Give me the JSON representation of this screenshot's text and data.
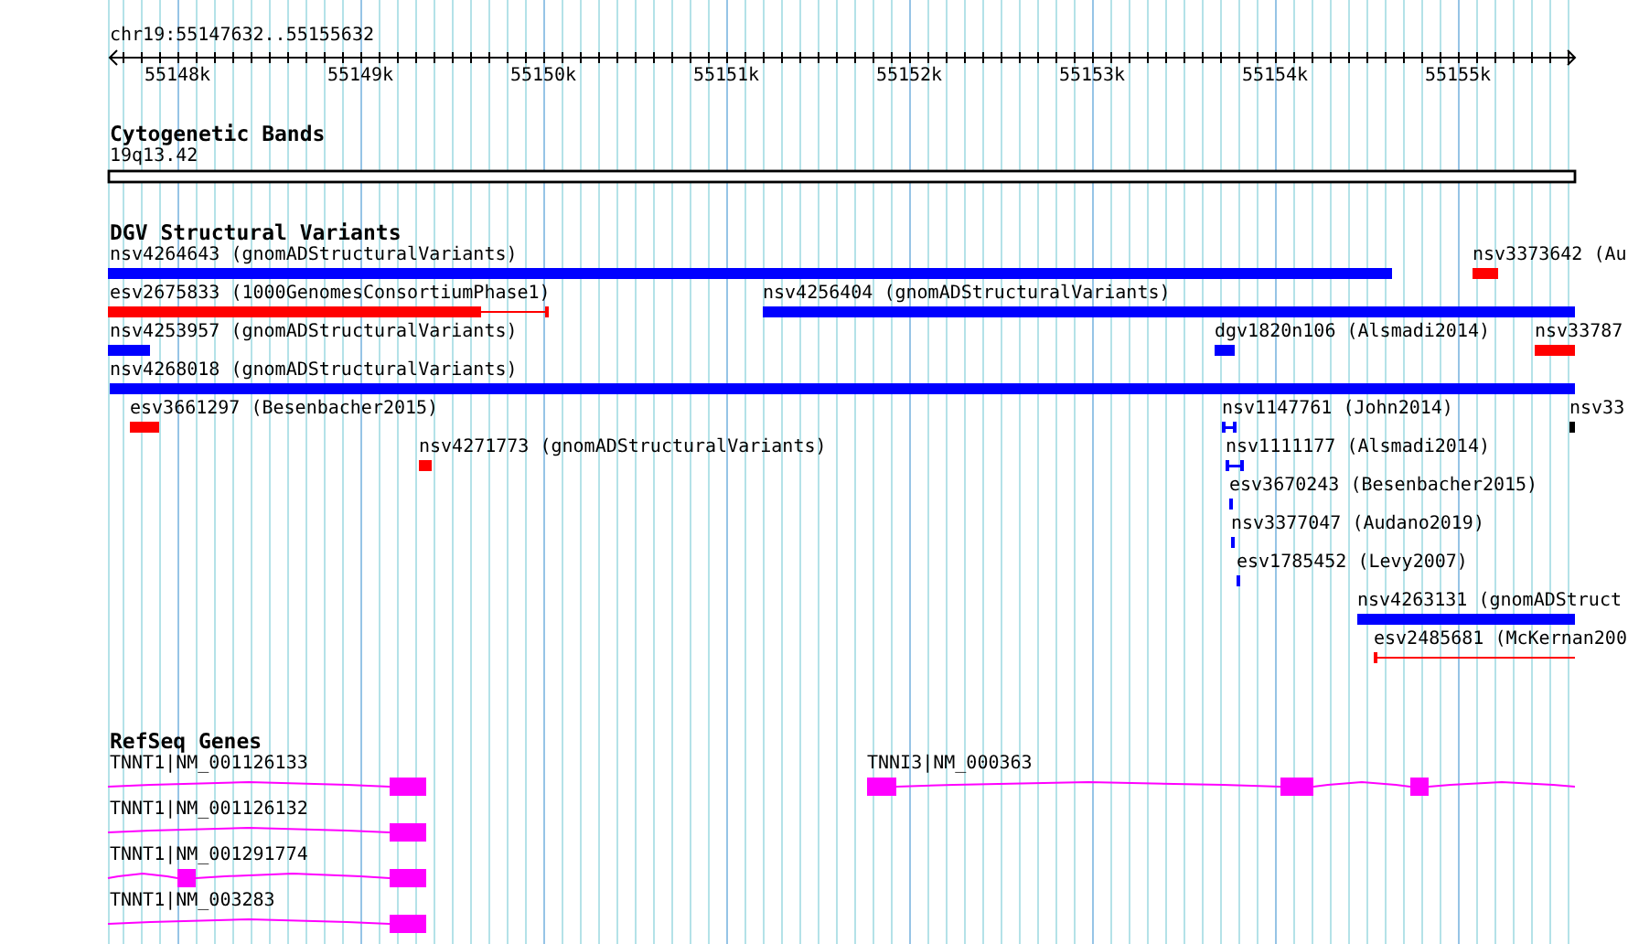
{
  "ruler": {
    "location": "chr19:55147632..55155632",
    "ticks": [
      {
        "label": "55148k"
      },
      {
        "label": "55149k"
      },
      {
        "label": "55150k"
      },
      {
        "label": "55151k"
      },
      {
        "label": "55152k"
      },
      {
        "label": "55153k"
      },
      {
        "label": "55154k"
      },
      {
        "label": "55155k"
      }
    ]
  },
  "tracks": [
    {
      "kind": "bands",
      "title": "Cytogenetic Bands",
      "band": {
        "label": "19q13.42"
      }
    },
    {
      "kind": "variants",
      "title": "DGV Structural Variants",
      "rows": [
        {
          "features": [
            {
              "label": "nsv4264643 (gnomADStructuralVariants)",
              "kind": "bar",
              "color": "#0000ff"
            },
            {
              "label": "nsv3373642 (Au",
              "kind": "bar",
              "color": "#ff0000"
            }
          ]
        },
        {
          "features": [
            {
              "label": "esv2675833 (1000GenomesConsortiumPhase1)",
              "kind": "bar_tail",
              "color": "#ff0000"
            },
            {
              "label": "nsv4256404 (gnomADStructuralVariants)",
              "kind": "bar",
              "color": "#0000ff"
            }
          ]
        },
        {
          "features": [
            {
              "label": "nsv4253957 (gnomADStructuralVariants)",
              "kind": "bar",
              "color": "#0000ff"
            },
            {
              "label": "dgv1820n106 (Alsmadi2014)",
              "kind": "bar",
              "color": "#0000ff"
            },
            {
              "label": "nsv33787",
              "kind": "bar",
              "color": "#ff0000"
            }
          ]
        },
        {
          "features": [
            {
              "label": "nsv4268018 (gnomADStructuralVariants)",
              "kind": "bar",
              "color": "#0000ff"
            }
          ]
        },
        {
          "features": [
            {
              "label": "esv3661297 (Besenbacher2015)",
              "kind": "bar",
              "color": "#ff0000"
            },
            {
              "label": "nsv1147761 (John2014)",
              "kind": "span",
              "color": "#0000ff"
            },
            {
              "label": "nsv33",
              "kind": "bar",
              "color": "#000000"
            }
          ]
        },
        {
          "features": [
            {
              "label": "nsv4271773 (gnomADStructuralVariants)",
              "kind": "bar",
              "color": "#ff0000"
            },
            {
              "label": "nsv1111177 (Alsmadi2014)",
              "kind": "span",
              "color": "#0000ff"
            }
          ]
        },
        {
          "features": [
            {
              "label": "esv3670243 (Besenbacher2015)",
              "kind": "bar",
              "color": "#0000ff"
            }
          ]
        },
        {
          "features": [
            {
              "label": "nsv3377047 (Audano2019)",
              "kind": "bar",
              "color": "#0000ff"
            }
          ]
        },
        {
          "features": [
            {
              "label": "esv1785452 (Levy2007)",
              "kind": "bar",
              "color": "#0000ff"
            }
          ]
        },
        {
          "features": [
            {
              "label": "nsv4263131 (gnomADStruct",
              "kind": "bar",
              "color": "#0000ff"
            }
          ]
        },
        {
          "features": [
            {
              "label": "esv2485681 (McKernan200",
              "kind": "line",
              "color": "#ff0000"
            }
          ]
        }
      ]
    },
    {
      "kind": "genes",
      "title": "RefSeq Genes",
      "rows": [
        {
          "genes": [
            {
              "label": "TNNT1|NM_001126133"
            },
            {
              "label": "TNNI3|NM_000363"
            }
          ]
        },
        {
          "genes": [
            {
              "label": "TNNT1|NM_001126132"
            }
          ]
        },
        {
          "genes": [
            {
              "label": "TNNT1|NM_001291774"
            }
          ]
        },
        {
          "genes": [
            {
              "label": "TNNT1|NM_003283"
            }
          ]
        }
      ]
    }
  ]
}
